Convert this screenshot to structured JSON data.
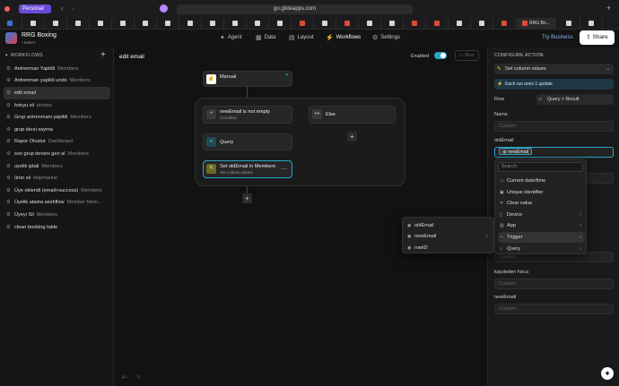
{
  "browser": {
    "profile_label": "Personal",
    "url": "go.glideapps.com",
    "active_tab_label": "RRG Bo...",
    "traffic_colors": [
      "#ff5f57",
      "#febc2e",
      "#28c840"
    ]
  },
  "app": {
    "name": "RRG Boxing",
    "role": "• Maker"
  },
  "topnav": [
    {
      "icon": "sparkle-icon",
      "label": "Agent"
    },
    {
      "icon": "data-icon",
      "label": "Data"
    },
    {
      "icon": "layout-icon",
      "label": "Layout"
    },
    {
      "icon": "workflows-icon",
      "label": "Workflows"
    },
    {
      "icon": "gear-icon",
      "label": "Settings"
    }
  ],
  "try_business": "Try Business",
  "share_label": "Share",
  "sidebar": {
    "title": "WORKFLOWS",
    "items": [
      {
        "label": "Antrenman Yapildi",
        "tag": "Members"
      },
      {
        "label": "Antrenman yapildi undo",
        "tag": "Members"
      },
      {
        "label": "edit email",
        "tag": ""
      },
      {
        "label": "fotoyu sil",
        "tag": "photos"
      },
      {
        "label": "Grup antrenmani yapildi",
        "tag": "Members"
      },
      {
        "label": "grup dersi sayma",
        "tag": ""
      },
      {
        "label": "Rapor Olustur",
        "tag": "Dashboard"
      },
      {
        "label": "son grup dersini geri al",
        "tag": "Members"
      },
      {
        "label": "uyelik iptali",
        "tag": "Members"
      },
      {
        "label": "ürün sil",
        "tag": "ekipmanlar"
      },
      {
        "label": "Üye eklendi (email+success)",
        "tag": "Members"
      },
      {
        "label": "Üyelik atama workflow",
        "tag": "Member Mem..."
      },
      {
        "label": "Üyeyi Sil",
        "tag": "Members"
      },
      {
        "label": "clean booking table",
        "tag": ""
      }
    ],
    "selected_index": 2
  },
  "canvas": {
    "title": "edit email",
    "enabled_label": "Enabled",
    "run_label": "Run",
    "nodes": {
      "manual": {
        "title": "Manual",
        "sub": ""
      },
      "condition": {
        "title": "newEmail is not empty",
        "sub": "Condition"
      },
      "else": {
        "title": "Else",
        "sub": ""
      },
      "query": {
        "title": "Query",
        "sub": ""
      },
      "set": {
        "title": "Set oldEmail in Members",
        "sub": "Set column values"
      }
    }
  },
  "panel": {
    "title": "CONFIGURE ACTION",
    "action_select": "Set column values",
    "info": "Each run uses 1 update",
    "row_label": "Row",
    "row_value": "Query  >  Result",
    "fields": [
      {
        "label": "Name",
        "placeholder": "Custom"
      },
      {
        "label": "oldEmail",
        "value": "newEmail"
      },
      {
        "label": "kaydeden hoca",
        "placeholder": "Custom"
      },
      {
        "label": "newEmail",
        "placeholder": "Custom"
      }
    ],
    "hidden_field_placeholder": "Custom"
  },
  "source_menu": {
    "search_placeholder": "Search",
    "items": [
      {
        "icon": "calendar-icon",
        "label": "Current date/time",
        "has_sub": false
      },
      {
        "icon": "id-icon",
        "label": "Unique identifier",
        "has_sub": false
      },
      {
        "icon": "close-icon",
        "label": "Clear value",
        "has_sub": false
      },
      {
        "icon": "device-icon",
        "label": "Device",
        "has_sub": true
      },
      {
        "icon": "app-icon",
        "label": "App",
        "has_sub": true
      },
      {
        "icon": "trigger-icon",
        "label": "Trigger",
        "has_sub": true
      },
      {
        "icon": "query-icon",
        "label": "Query",
        "has_sub": true
      }
    ],
    "highlighted": "Trigger"
  },
  "trigger_submenu": {
    "items": [
      {
        "label": "oldEmail",
        "checked": false
      },
      {
        "label": "newEmail",
        "checked": true
      },
      {
        "label": "rowID",
        "checked": false
      }
    ]
  },
  "colors": {
    "accent": "#2aa5c4",
    "workflows_icon": "#e05a4a",
    "profile": "#6b4bd6"
  }
}
